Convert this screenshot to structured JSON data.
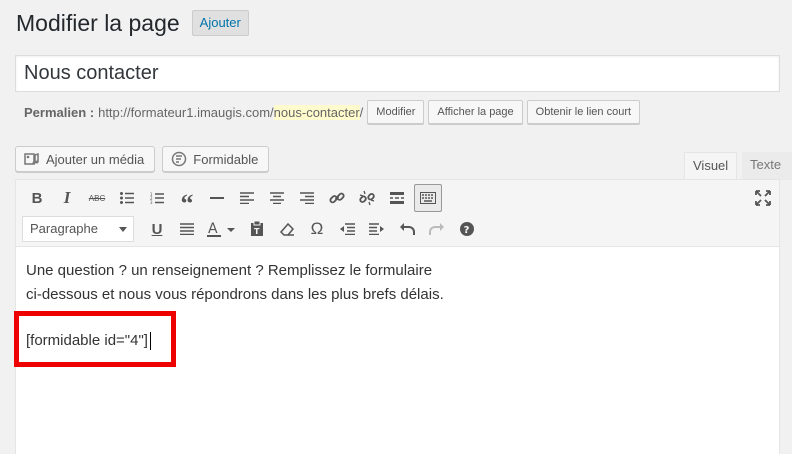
{
  "header": {
    "title": "Modifier la page",
    "add_label": "Ajouter"
  },
  "post_title": "Nous contacter",
  "permalink": {
    "label": "Permalien :",
    "base_url": "http://formateur1.imaugis.com/",
    "slug": "nous-contacter",
    "trailing": "/",
    "buttons": {
      "edit": "Modifier",
      "view": "Afficher la page",
      "shortlink": "Obtenir le lien court"
    }
  },
  "media_buttons": {
    "add_media": "Ajouter un média",
    "formidable": "Formidable"
  },
  "editor_tabs": {
    "visual": "Visuel",
    "text": "Texte",
    "active": "Visuel"
  },
  "toolbar": {
    "row1_icons": [
      "bold-icon",
      "italic-icon",
      "strikethrough-icon",
      "bullet-list-icon",
      "numbered-list-icon",
      "blockquote-icon",
      "horizontal-rule-icon",
      "align-left-icon",
      "align-center-icon",
      "align-right-icon",
      "insert-link-icon",
      "remove-link-icon",
      "read-more-icon",
      "toolbar-toggle-icon"
    ],
    "format_select": "Paragraphe",
    "row2_icons": [
      "underline-icon",
      "justify-icon",
      "text-color-icon",
      "paste-as-text-icon",
      "clear-formatting-icon",
      "special-character-icon",
      "outdent-icon",
      "indent-icon",
      "undo-icon",
      "redo-icon",
      "help-icon"
    ]
  },
  "content": {
    "line1": "Une question ? un renseignement ? Remplissez le formulaire",
    "line2": "ci-dessous et nous vous répondrons dans les plus brefs délais.",
    "shortcode": "[formidable id=\"4\"]"
  },
  "colors": {
    "highlight_box": "#e00000",
    "link": "#0073aa",
    "slug_highlight": "#fffbcc"
  }
}
